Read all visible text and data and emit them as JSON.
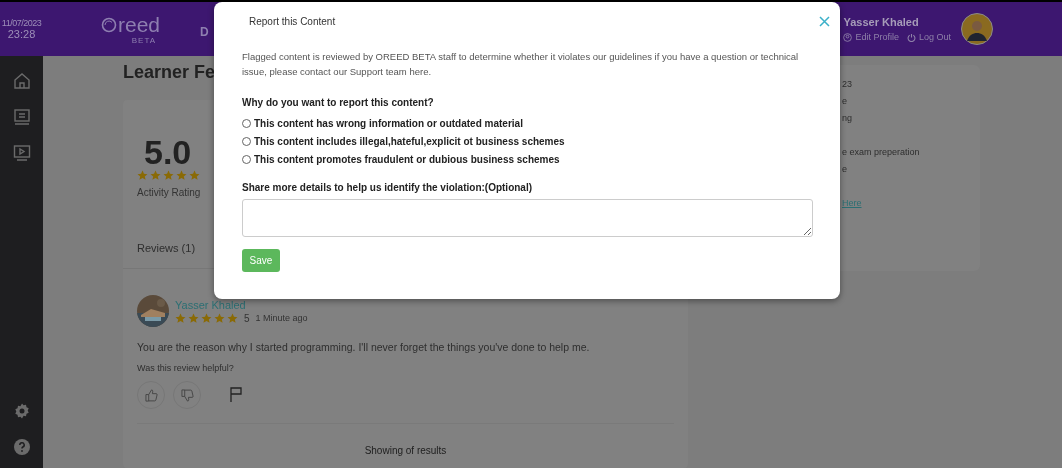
{
  "header": {
    "date": "11/07/2023",
    "time": "23:28",
    "logo": "reed",
    "logo_badge": "BETA",
    "nav_fragment": "D",
    "user": {
      "name": "Yasser Khaled",
      "links": [
        "Edit Profile",
        "Log Out"
      ]
    }
  },
  "page_title": "Learner Fe",
  "rating": {
    "score": "5.0",
    "stars": 5,
    "label": "Activity Rating"
  },
  "reviews_tab": "Reviews (1)",
  "reviews": [
    {
      "author": "Yasser Khaled",
      "stars": 5,
      "score": "5",
      "time": "1 Minute ago",
      "text": "You are the reason why I started programming. I'll never forget the things you've done to help me.",
      "helpful_prompt": "Was this review helpful?"
    }
  ],
  "results_text": "Showing of results",
  "side_card": {
    "lines": [
      {
        "kind": "text",
        "text": "23"
      },
      {
        "kind": "text",
        "text": "e"
      },
      {
        "kind": "text",
        "text": "ng"
      },
      {
        "kind": "gap"
      },
      {
        "kind": "text",
        "text": "e exam preperation"
      },
      {
        "kind": "text",
        "text": "e"
      },
      {
        "kind": "gap"
      },
      {
        "kind": "link",
        "text": "Here"
      }
    ]
  },
  "modal": {
    "title": "Report this Content",
    "intro": "Flagged content is reviewed by OREED BETA staff to determine whether it violates our guidelines if you have a question or technical issue, please contact our Support team here.",
    "question": "Why do you want to report this content?",
    "options": [
      {
        "label": "This content has wrong information or outdated material",
        "selected": false
      },
      {
        "label": "This content includes illegal,hateful,explicit ot business schemes",
        "selected": false
      },
      {
        "label": "This content promotes fraudulent or dubious business schemes",
        "selected": false
      }
    ],
    "details_label": "Share more details to help us identify the violation:(Optional)",
    "save": "Save"
  }
}
